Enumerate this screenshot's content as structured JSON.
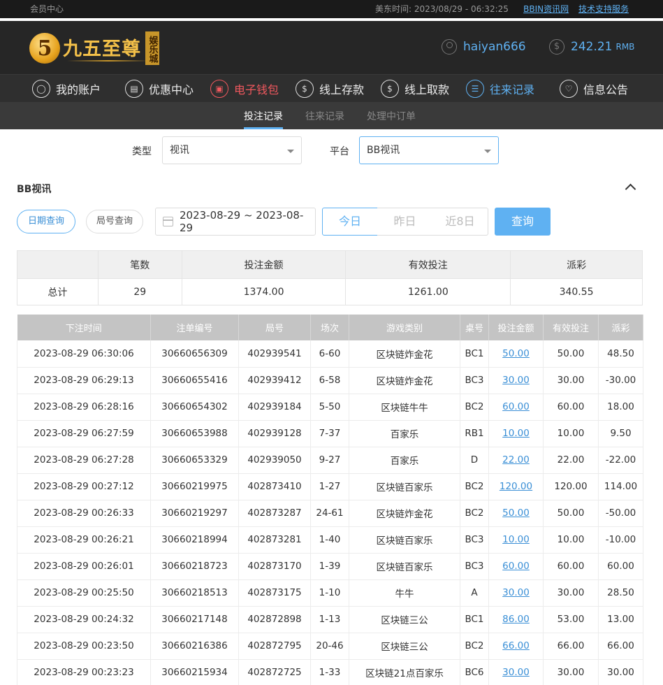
{
  "topbar": {
    "member_center": "会员中心",
    "time_label": "美东时间:",
    "time_value": "2023/08/29 - 06:32:25",
    "link_bbin": "BBIN资讯网",
    "link_support": "技术支持服务"
  },
  "header": {
    "logo_number": "5",
    "logo_text": "九五至尊",
    "logo_seal": "娱乐城",
    "username": "haiyan666",
    "balance": "242.21",
    "currency": "RMB"
  },
  "nav": [
    {
      "label": "我的账户",
      "icon": "user-icon"
    },
    {
      "label": "优惠中心",
      "icon": "gift-icon"
    },
    {
      "label": "电子钱包",
      "icon": "wallet-icon"
    },
    {
      "label": "线上存款",
      "icon": "deposit-icon"
    },
    {
      "label": "线上取款",
      "icon": "withdraw-icon"
    },
    {
      "label": "往来记录",
      "icon": "record-icon"
    },
    {
      "label": "信息公告",
      "icon": "bell-icon"
    }
  ],
  "subtabs": [
    "投注记录",
    "往来记录",
    "处理中订单"
  ],
  "filters": {
    "type_label": "类型",
    "type_value": "视讯",
    "platform_label": "平台",
    "platform_value": "BB视讯"
  },
  "section_title": "BB视讯",
  "query_modes": [
    "日期查询",
    "局号查询"
  ],
  "date_range": "2023-08-29 ~ 2023-08-29",
  "quick_dates": [
    "今日",
    "昨日",
    "近8日"
  ],
  "query_button": "查询",
  "summary": {
    "headers": [
      "",
      "笔数",
      "投注金额",
      "有效投注",
      "派彩"
    ],
    "row": [
      "总计",
      "29",
      "1374.00",
      "1261.00",
      "340.55"
    ]
  },
  "detail": {
    "headers": [
      "下注时间",
      "注单编号",
      "局号",
      "场次",
      "游戏类别",
      "桌号",
      "投注金额",
      "有效投注",
      "派彩"
    ],
    "rows": [
      [
        "2023-08-29 06:30:06",
        "30660656309",
        "402939541",
        "6-60",
        "区块链炸金花",
        "BC1",
        "50.00",
        "50.00",
        "48.50"
      ],
      [
        "2023-08-29 06:29:13",
        "30660655416",
        "402939412",
        "6-58",
        "区块链炸金花",
        "BC3",
        "30.00",
        "30.00",
        "-30.00"
      ],
      [
        "2023-08-29 06:28:16",
        "30660654302",
        "402939184",
        "5-50",
        "区块链牛牛",
        "BC2",
        "60.00",
        "60.00",
        "18.00"
      ],
      [
        "2023-08-29 06:27:59",
        "30660653988",
        "402939128",
        "7-37",
        "百家乐",
        "RB1",
        "10.00",
        "10.00",
        "9.50"
      ],
      [
        "2023-08-29 06:27:28",
        "30660653329",
        "402939050",
        "9-27",
        "百家乐",
        "D",
        "22.00",
        "22.00",
        "-22.00"
      ],
      [
        "2023-08-29 00:27:12",
        "30660219975",
        "402873410",
        "1-27",
        "区块链百家乐",
        "BC2",
        "120.00",
        "120.00",
        "114.00"
      ],
      [
        "2023-08-29 00:26:33",
        "30660219297",
        "402873287",
        "24-61",
        "区块链炸金花",
        "BC2",
        "50.00",
        "50.00",
        "-50.00"
      ],
      [
        "2023-08-29 00:26:21",
        "30660218994",
        "402873281",
        "1-40",
        "区块链百家乐",
        "BC3",
        "10.00",
        "10.00",
        "-10.00"
      ],
      [
        "2023-08-29 00:26:01",
        "30660218723",
        "402873170",
        "1-39",
        "区块链百家乐",
        "BC3",
        "60.00",
        "60.00",
        "60.00"
      ],
      [
        "2023-08-29 00:25:50",
        "30660218513",
        "402873175",
        "1-10",
        "牛牛",
        "A",
        "30.00",
        "30.00",
        "28.50"
      ],
      [
        "2023-08-29 00:24:32",
        "30660217148",
        "402872898",
        "1-13",
        "区块链三公",
        "BC1",
        "86.00",
        "53.00",
        "13.00"
      ],
      [
        "2023-08-29 00:23:50",
        "30660216386",
        "402872795",
        "20-46",
        "区块链三公",
        "BC2",
        "66.00",
        "66.00",
        "66.00"
      ],
      [
        "2023-08-29 00:23:23",
        "30660215934",
        "402872725",
        "1-33",
        "区块链21点百家乐",
        "BC6",
        "30.00",
        "30.00",
        "30.00"
      ]
    ]
  },
  "colors": {
    "accent": "#5fb1f2",
    "negative": "#e53935",
    "nav_active_red": "#f0585e",
    "header_bg": "#262626"
  }
}
